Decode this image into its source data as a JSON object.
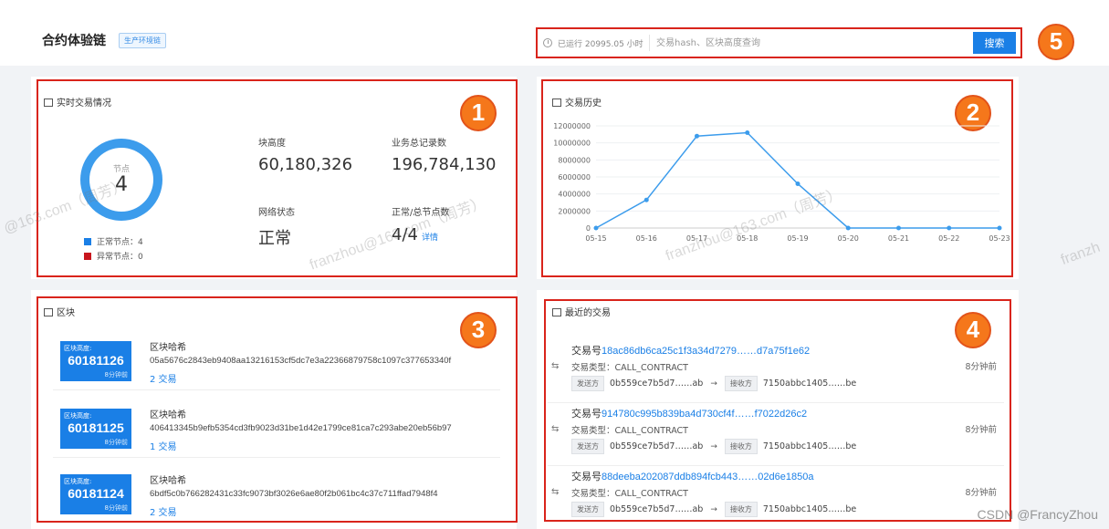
{
  "header": {
    "title": "合约体验链",
    "env_badge": "生产环境链",
    "uptime": "已运行 20995.05 小时",
    "search_placeholder": "交易hash、区块高度查询",
    "search_button": "搜索"
  },
  "annotations": [
    "1",
    "2",
    "3",
    "4",
    "5"
  ],
  "realtime": {
    "title": "实时交易情况",
    "donut_label": "节点",
    "donut_value": "4",
    "legend": [
      {
        "label": "正常节点：4",
        "color": "#1a7fe6"
      },
      {
        "label": "异常节点：0",
        "color": "#c8161d"
      }
    ],
    "stats": [
      {
        "label": "块高度",
        "value": "60,180,326"
      },
      {
        "label": "业务总记录数",
        "value": "196,784,130"
      },
      {
        "label": "网络状态",
        "value": "正常"
      },
      {
        "label": "正常/总节点数",
        "value": "4/4"
      }
    ],
    "detail_link": "详情"
  },
  "history": {
    "title": "交易历史"
  },
  "chart_data": {
    "type": "line",
    "x": [
      "05-15",
      "05-16",
      "05-17",
      "05-18",
      "05-19",
      "05-20",
      "05-21",
      "05-22",
      "05-23"
    ],
    "series": [
      {
        "values": [
          0,
          3300000,
          10800000,
          11200000,
          5200000,
          0,
          0,
          0,
          0
        ]
      }
    ],
    "yticks": [
      "0",
      "2000000",
      "4000000",
      "6000000",
      "8000000",
      "10000000",
      "12000000"
    ],
    "ylim": [
      0,
      12000000
    ],
    "color": "#3c9cec"
  },
  "blocks": {
    "title": "区块",
    "height_caption": "区块高度:",
    "hash_caption": "区块哈希",
    "items": [
      {
        "height": "60181126",
        "ago": "8分钟前",
        "hash": "05a5676c2843eb9408aa13216153cf5dc7e3a22366879758c1097c377653340f",
        "tx": "2 交易"
      },
      {
        "height": "60181125",
        "ago": "8分钟前",
        "hash": "406413345b9efb5354cd3fb9023d31be1d42e1799ce81ca7c293abe20eb56b97",
        "tx": "1 交易"
      },
      {
        "height": "60181124",
        "ago": "8分钟前",
        "hash": "6bdf5c0b766282431c33fc9073bf3026e6ae80f2b061bc4c37c711ffad7948f4",
        "tx": "2 交易"
      }
    ]
  },
  "transactions": {
    "title": "最近的交易",
    "tx_prefix": "交易号",
    "type_label": "交易类型：",
    "sender_tag": "发送方",
    "receiver_tag": "接收方",
    "items": [
      {
        "hash": "18ac86db6ca25c1f3a34d7279……d7a75f1e62",
        "type": "CALL_CONTRACT",
        "from": "0b559ce7b5d7……ab",
        "to": "7150abbc1405……be",
        "time": "8分钟前"
      },
      {
        "hash": "914780c995b839ba4d730cf4f……f7022d26c2",
        "type": "CALL_CONTRACT",
        "from": "0b559ce7b5d7……ab",
        "to": "7150abbc1405……be",
        "time": "8分钟前"
      },
      {
        "hash": "88deeba202087ddb894fcb443……02d6e1850a",
        "type": "CALL_CONTRACT",
        "from": "0b559ce7b5d7……ab",
        "to": "7150abbc1405……be",
        "time": "8分钟前"
      }
    ]
  },
  "watermarks": [
    "@163.com（周芳）",
    "franzhou@163.com（周芳）",
    "franzhou@163.com（周芳）",
    "franzh"
  ],
  "footer": {
    "csdn": "CSDN @FrancyZhou"
  }
}
